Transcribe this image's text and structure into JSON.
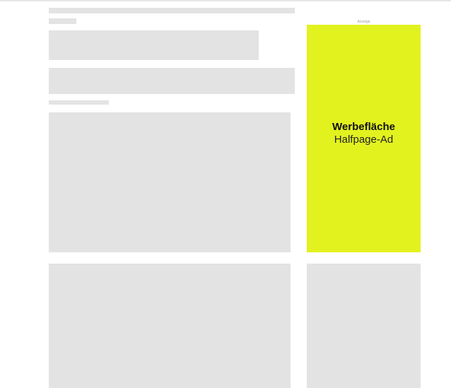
{
  "colors": {
    "placeholder": "#e3e3e3",
    "ad_background": "#e2f21f",
    "ad_text": "#111111",
    "label_text": "#9a9a9a"
  },
  "ad": {
    "label": "Anzeige",
    "title": "Werbefläche",
    "subtitle": "Halfpage-Ad"
  }
}
